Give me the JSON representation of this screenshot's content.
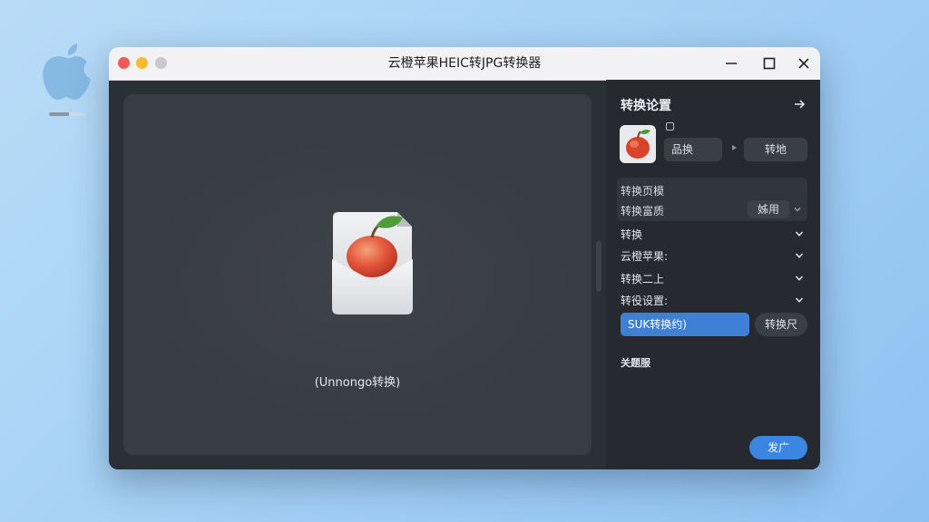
{
  "window": {
    "title": "云橙苹果HEIC转JPG转换器"
  },
  "canvas": {
    "drop_text": "(Unnongo转换)"
  },
  "panel": {
    "header": "转换论置",
    "actions": {
      "left_label": "品换",
      "right_label": "转地"
    },
    "properties": {
      "line1": "转换页模",
      "line2": "转换富质",
      "line2_value": "姊用"
    },
    "sections": [
      {
        "label": "转换"
      },
      {
        "label": "云橙苹果:"
      },
      {
        "label": "转换二上"
      },
      {
        "label": "转役设置:"
      }
    ],
    "primary_button": "SUK转换约)",
    "secondary_button": "转换尺",
    "subsection_label": "关题服",
    "start_button": "发广"
  },
  "colors": {
    "accent": "#3f7fd6",
    "panel_bg": "#262a30",
    "canvas_bg": "#383c43"
  },
  "icons": {
    "desktop": "apple-logo-icon",
    "file": "heic-file-icon",
    "thumbnail": "apple-thumbnail-icon"
  }
}
